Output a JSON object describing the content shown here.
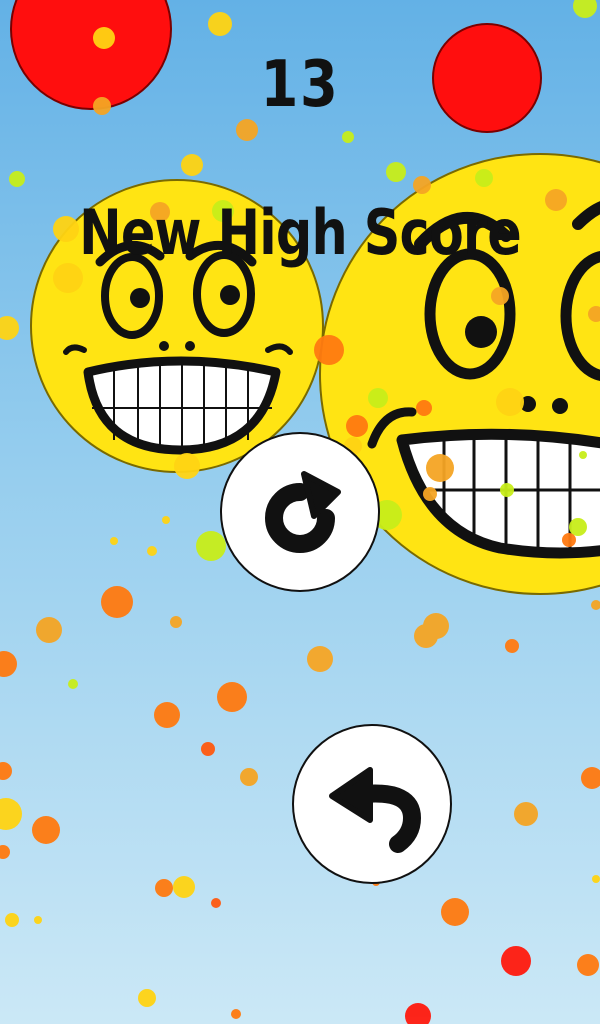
{
  "game": {
    "score": "13",
    "headline": "New High Score"
  },
  "buttons": {
    "restart": {
      "icon": "restart-icon"
    },
    "back": {
      "icon": "undo-arrow-icon"
    }
  },
  "colors": {
    "sky_top": "#63b1e6",
    "sky_bottom": "#cbe8f6",
    "smiley_face": "#ffe413",
    "red_ball": "#ff0e0e",
    "confetti": [
      "#ff7a10",
      "#f5a524",
      "#ffd413",
      "#c8ee1a"
    ]
  }
}
